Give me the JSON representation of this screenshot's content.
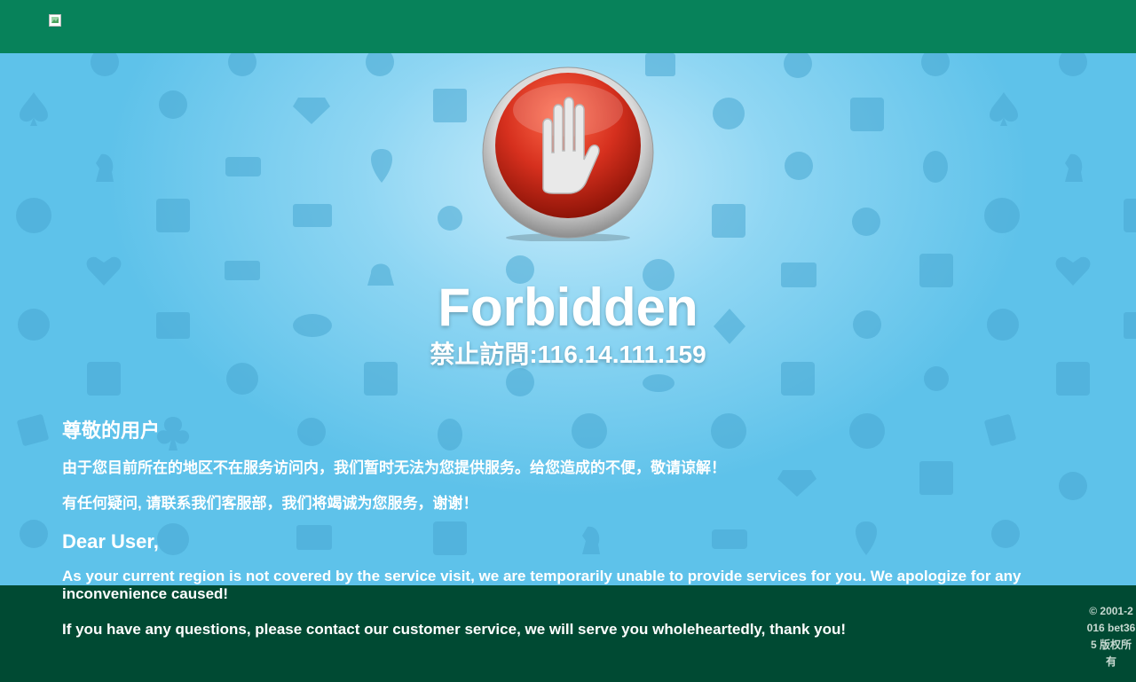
{
  "header": {
    "logo_alt": "",
    "bg_color": "#07825a"
  },
  "hero": {
    "icon": "stop-hand-icon",
    "title": "Forbidden",
    "subtitle": "禁止訪問:116.14.111.159"
  },
  "message": {
    "cn_heading": "尊敬的用户",
    "cn_line1": "由于您目前所在的地区不在服务访问内，我们暂时无法为您提供服务。给您造成的不便，敬请谅解！",
    "cn_line2": "有任何疑问, 请联系我们客服部，我们将竭诚为您服务，谢谢！",
    "en_heading": "Dear User,",
    "en_line1": "As your current region is not covered by the service visit, we are temporarily unable to provide services for you. We apologize for any inconvenience caused!",
    "en_line2": "If you have any questions, please contact our customer service, we will serve you wholeheartedly, thank you!"
  },
  "footer": {
    "copyright": "© 2001-2016 bet365 版权所有",
    "bg_color": "#004a33"
  },
  "colors": {
    "background": "#5fc3ea",
    "stop_red": "#d6301e"
  }
}
